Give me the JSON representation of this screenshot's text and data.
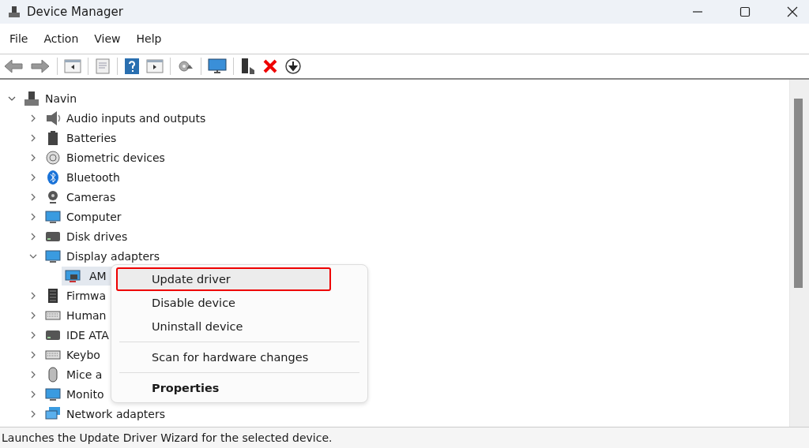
{
  "window": {
    "title": "Device Manager"
  },
  "menu_bar": [
    "File",
    "Action",
    "View",
    "Help"
  ],
  "tree": {
    "label": "Navin",
    "expanded": true,
    "children": [
      {
        "label": "Audio inputs and outputs",
        "expanded": false
      },
      {
        "label": "Batteries",
        "expanded": false
      },
      {
        "label": "Biometric devices",
        "expanded": false
      },
      {
        "label": "Bluetooth",
        "expanded": false
      },
      {
        "label": "Cameras",
        "expanded": false
      },
      {
        "label": "Computer",
        "expanded": false
      },
      {
        "label": "Disk drives",
        "expanded": false
      },
      {
        "label": "Display adapters",
        "expanded": true,
        "children": [
          {
            "label": "AM",
            "selected": true
          }
        ]
      },
      {
        "label": "Firmwa",
        "expanded": false
      },
      {
        "label": "Human",
        "expanded": false
      },
      {
        "label": "IDE ATA",
        "expanded": false
      },
      {
        "label": "Keybo",
        "expanded": false
      },
      {
        "label": "Mice a",
        "expanded": false
      },
      {
        "label": "Monito",
        "expanded": false
      },
      {
        "label": "Network adapters",
        "expanded": false
      }
    ]
  },
  "context_menu": [
    {
      "kind": "item",
      "label": "Update driver",
      "selected": true
    },
    {
      "kind": "item",
      "label": "Disable device",
      "selected": false
    },
    {
      "kind": "item",
      "label": "Uninstall device",
      "selected": false
    },
    {
      "kind": "separator"
    },
    {
      "kind": "item",
      "label": "Scan for hardware changes",
      "selected": false
    },
    {
      "kind": "separator"
    },
    {
      "kind": "default",
      "label": "Properties",
      "selected": false
    }
  ],
  "status_bar": "Launches the Update Driver Wizard for the selected device."
}
